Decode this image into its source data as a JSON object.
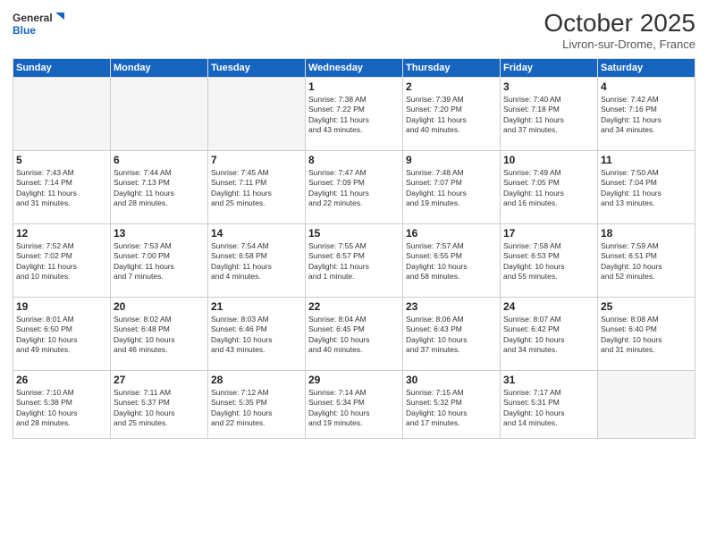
{
  "header": {
    "logo_line1": "General",
    "logo_line2": "Blue",
    "month": "October 2025",
    "location": "Livron-sur-Drome, France"
  },
  "weekdays": [
    "Sunday",
    "Monday",
    "Tuesday",
    "Wednesday",
    "Thursday",
    "Friday",
    "Saturday"
  ],
  "weeks": [
    [
      {
        "day": "",
        "info": ""
      },
      {
        "day": "",
        "info": ""
      },
      {
        "day": "",
        "info": ""
      },
      {
        "day": "1",
        "info": "Sunrise: 7:38 AM\nSunset: 7:22 PM\nDaylight: 11 hours\nand 43 minutes."
      },
      {
        "day": "2",
        "info": "Sunrise: 7:39 AM\nSunset: 7:20 PM\nDaylight: 11 hours\nand 40 minutes."
      },
      {
        "day": "3",
        "info": "Sunrise: 7:40 AM\nSunset: 7:18 PM\nDaylight: 11 hours\nand 37 minutes."
      },
      {
        "day": "4",
        "info": "Sunrise: 7:42 AM\nSunset: 7:16 PM\nDaylight: 11 hours\nand 34 minutes."
      }
    ],
    [
      {
        "day": "5",
        "info": "Sunrise: 7:43 AM\nSunset: 7:14 PM\nDaylight: 11 hours\nand 31 minutes."
      },
      {
        "day": "6",
        "info": "Sunrise: 7:44 AM\nSunset: 7:13 PM\nDaylight: 11 hours\nand 28 minutes."
      },
      {
        "day": "7",
        "info": "Sunrise: 7:45 AM\nSunset: 7:11 PM\nDaylight: 11 hours\nand 25 minutes."
      },
      {
        "day": "8",
        "info": "Sunrise: 7:47 AM\nSunset: 7:09 PM\nDaylight: 11 hours\nand 22 minutes."
      },
      {
        "day": "9",
        "info": "Sunrise: 7:48 AM\nSunset: 7:07 PM\nDaylight: 11 hours\nand 19 minutes."
      },
      {
        "day": "10",
        "info": "Sunrise: 7:49 AM\nSunset: 7:05 PM\nDaylight: 11 hours\nand 16 minutes."
      },
      {
        "day": "11",
        "info": "Sunrise: 7:50 AM\nSunset: 7:04 PM\nDaylight: 11 hours\nand 13 minutes."
      }
    ],
    [
      {
        "day": "12",
        "info": "Sunrise: 7:52 AM\nSunset: 7:02 PM\nDaylight: 11 hours\nand 10 minutes."
      },
      {
        "day": "13",
        "info": "Sunrise: 7:53 AM\nSunset: 7:00 PM\nDaylight: 11 hours\nand 7 minutes."
      },
      {
        "day": "14",
        "info": "Sunrise: 7:54 AM\nSunset: 6:58 PM\nDaylight: 11 hours\nand 4 minutes."
      },
      {
        "day": "15",
        "info": "Sunrise: 7:55 AM\nSunset: 6:57 PM\nDaylight: 11 hours\nand 1 minute."
      },
      {
        "day": "16",
        "info": "Sunrise: 7:57 AM\nSunset: 6:55 PM\nDaylight: 10 hours\nand 58 minutes."
      },
      {
        "day": "17",
        "info": "Sunrise: 7:58 AM\nSunset: 6:53 PM\nDaylight: 10 hours\nand 55 minutes."
      },
      {
        "day": "18",
        "info": "Sunrise: 7:59 AM\nSunset: 6:51 PM\nDaylight: 10 hours\nand 52 minutes."
      }
    ],
    [
      {
        "day": "19",
        "info": "Sunrise: 8:01 AM\nSunset: 6:50 PM\nDaylight: 10 hours\nand 49 minutes."
      },
      {
        "day": "20",
        "info": "Sunrise: 8:02 AM\nSunset: 6:48 PM\nDaylight: 10 hours\nand 46 minutes."
      },
      {
        "day": "21",
        "info": "Sunrise: 8:03 AM\nSunset: 6:46 PM\nDaylight: 10 hours\nand 43 minutes."
      },
      {
        "day": "22",
        "info": "Sunrise: 8:04 AM\nSunset: 6:45 PM\nDaylight: 10 hours\nand 40 minutes."
      },
      {
        "day": "23",
        "info": "Sunrise: 8:06 AM\nSunset: 6:43 PM\nDaylight: 10 hours\nand 37 minutes."
      },
      {
        "day": "24",
        "info": "Sunrise: 8:07 AM\nSunset: 6:42 PM\nDaylight: 10 hours\nand 34 minutes."
      },
      {
        "day": "25",
        "info": "Sunrise: 8:08 AM\nSunset: 6:40 PM\nDaylight: 10 hours\nand 31 minutes."
      }
    ],
    [
      {
        "day": "26",
        "info": "Sunrise: 7:10 AM\nSunset: 5:38 PM\nDaylight: 10 hours\nand 28 minutes."
      },
      {
        "day": "27",
        "info": "Sunrise: 7:11 AM\nSunset: 5:37 PM\nDaylight: 10 hours\nand 25 minutes."
      },
      {
        "day": "28",
        "info": "Sunrise: 7:12 AM\nSunset: 5:35 PM\nDaylight: 10 hours\nand 22 minutes."
      },
      {
        "day": "29",
        "info": "Sunrise: 7:14 AM\nSunset: 5:34 PM\nDaylight: 10 hours\nand 19 minutes."
      },
      {
        "day": "30",
        "info": "Sunrise: 7:15 AM\nSunset: 5:32 PM\nDaylight: 10 hours\nand 17 minutes."
      },
      {
        "day": "31",
        "info": "Sunrise: 7:17 AM\nSunset: 5:31 PM\nDaylight: 10 hours\nand 14 minutes."
      },
      {
        "day": "",
        "info": ""
      }
    ]
  ]
}
